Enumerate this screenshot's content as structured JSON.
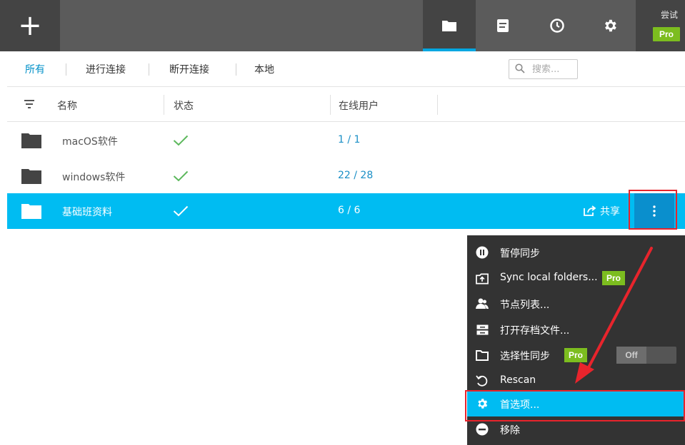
{
  "topbar": {
    "add_icon": "plus-icon",
    "icons": [
      "folder-icon",
      "document-icon",
      "clock-icon",
      "gear-icon"
    ],
    "trial_label": "尝试",
    "pro_label": "Pro"
  },
  "filters": {
    "items": [
      "所有",
      "进行连接",
      "断开连接",
      "本地"
    ],
    "active": "所有"
  },
  "search": {
    "placeholder": "搜索..."
  },
  "table": {
    "headers": {
      "name": "名称",
      "status": "状态",
      "users": "在线用户"
    },
    "rows": [
      {
        "name": "macOS软件",
        "status": "check-icon",
        "users": "1 / 1"
      },
      {
        "name": "windows软件",
        "status": "check-icon",
        "users": "22 / 28"
      },
      {
        "name": "基础班资料",
        "status": "check-icon",
        "users": "6 / 6"
      }
    ],
    "share_label": "共享"
  },
  "menu": {
    "items": [
      {
        "icon": "pause-icon",
        "label": "暂停同步"
      },
      {
        "icon": "upload-folder-icon",
        "label": "Sync local folders...",
        "badge": "Pro"
      },
      {
        "icon": "users-icon",
        "label": "节点列表..."
      },
      {
        "icon": "archive-icon",
        "label": "打开存档文件..."
      },
      {
        "icon": "folder-outline-icon",
        "label": "选择性同步",
        "badge": "Pro",
        "toggle": "Off"
      },
      {
        "icon": "rescan-icon",
        "label": "Rescan"
      },
      {
        "icon": "gear-icon",
        "label": "首选项..."
      },
      {
        "icon": "remove-icon",
        "label": "移除"
      }
    ]
  },
  "colors": {
    "topbar": "#5b5b5b",
    "accent": "#00bcf2",
    "pro_green": "#7cbd1f",
    "check_green": "#5cb85c",
    "annotation_red": "#e8242c"
  }
}
